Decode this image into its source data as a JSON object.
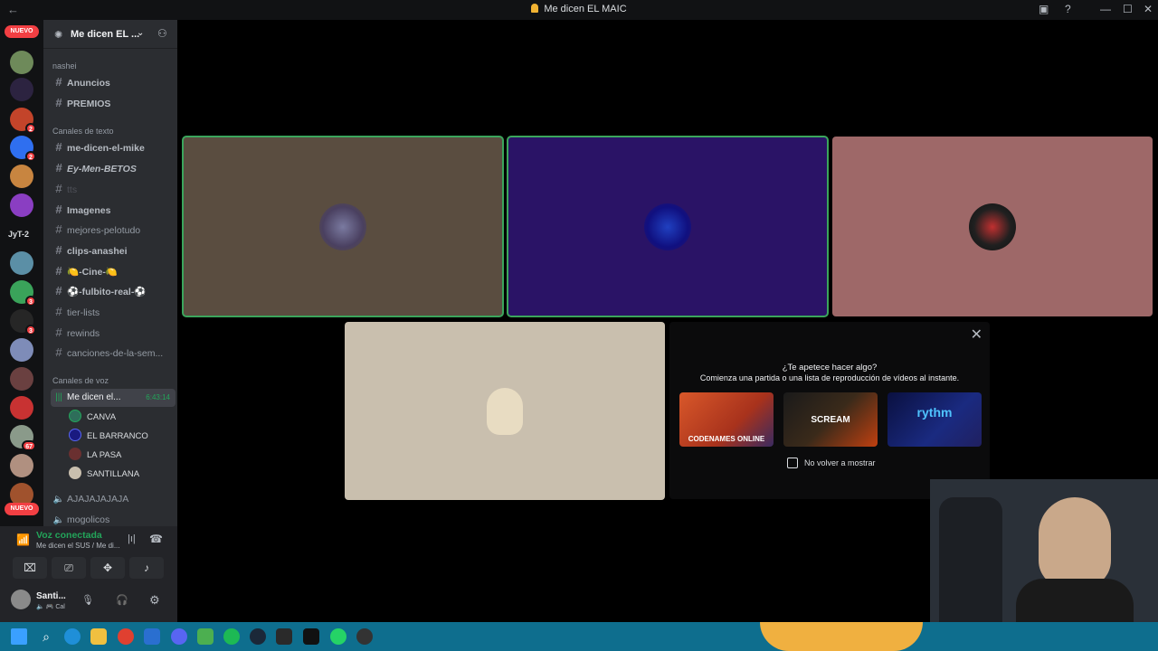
{
  "window": {
    "title": "Me dicen EL MAIC",
    "back_icon": "arrow-left-icon"
  },
  "colors": {
    "speaking": "#3ba55c",
    "connected": "#23a55a",
    "badge": "#f23f43",
    "taskbar": "#0e6e8e"
  },
  "rail": {
    "nuevo_top": "NUEVO",
    "badges": [
      "41",
      "2",
      "2",
      "3",
      "3",
      "67"
    ],
    "jyt": "JyT-2",
    "nuevo_bottom": "NUEVO"
  },
  "guild": {
    "name": "Me dicen EL ..."
  },
  "categories": {
    "nashei": "nashei",
    "text": "Canales de texto",
    "voice": "Canales de voz"
  },
  "channels": {
    "anuncios": "Anuncios",
    "premios": "PREMIOS",
    "me_dicen_mike": "me-dicen-el-mike",
    "ey_men": "Ey-Men-BETOS",
    "tts": "tts",
    "imagenes": "Imagenes",
    "mejores": "mejores-pelotudo",
    "clips": "clips-anashei",
    "cine": "🍋-Cine-🍋",
    "fulbito": "⚽-fulbito-real-⚽",
    "tier": "tier-lists",
    "rewinds": "rewinds",
    "canciones": "canciones-de-la-sem..."
  },
  "voice_channel": {
    "name": "Me dicen el...",
    "timer": "6:43:14"
  },
  "members": [
    "CANVA",
    "EL BARRANCO",
    "LA PASA",
    "SANTILLANA"
  ],
  "voice_channels_more": {
    "a": "AJAJAJAJAJA",
    "b": "mogolicos"
  },
  "voice_panel": {
    "status": "Voz conectada",
    "sub": "Me dicen el SUS / Me di..."
  },
  "user": {
    "name": "Santi...",
    "status": "🔈 🎮 Cal"
  },
  "activity": {
    "question": "¿Te apetece hacer algo?",
    "desc": "Comienza una partida o una lista de reproducción de vídeos al instante.",
    "cards": [
      "CODENAMES ONLINE",
      "SCREAM",
      "rythm"
    ],
    "checkbox": "No volver a mostrar"
  }
}
